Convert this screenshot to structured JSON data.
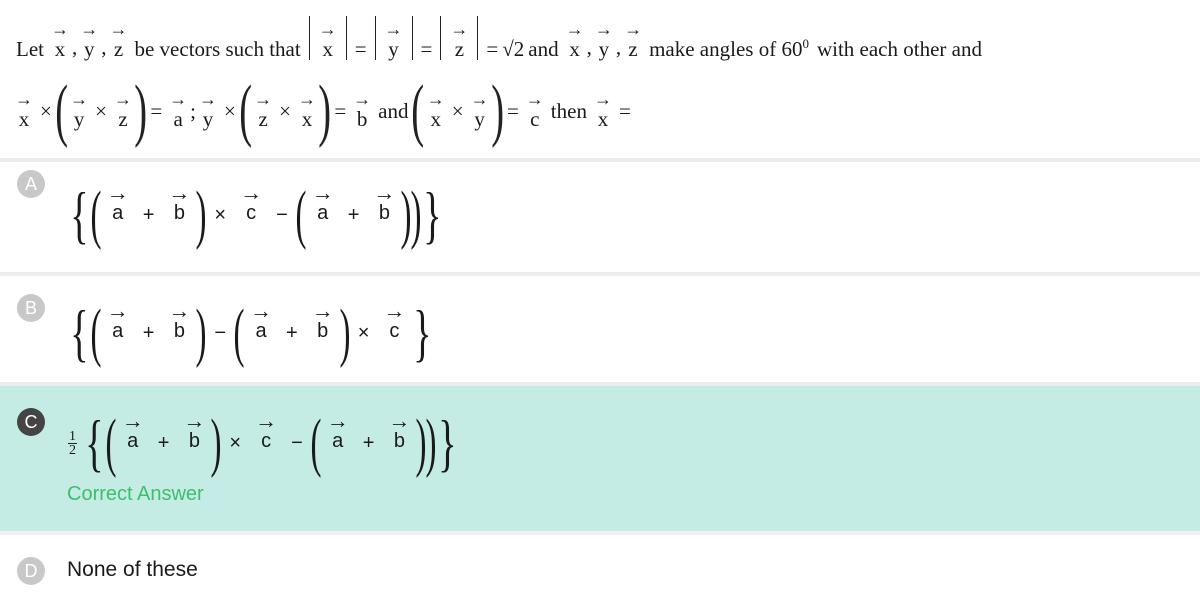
{
  "question": {
    "line1": {
      "lead": "Let",
      "vectors": [
        "x",
        "y",
        "z"
      ],
      "sep": ",",
      "mid": "be vectors such that",
      "magnitudes": [
        "x",
        "y",
        "z"
      ],
      "eq": "=",
      "value": "√2",
      "and": "and",
      "tail": "make angles of 60",
      "deg": "0",
      "end": "with each other and"
    },
    "line2": {
      "x": "x",
      "y": "y",
      "z": "z",
      "cross": "×",
      "eq": "=",
      "a": "a",
      "semicolon": ";",
      "b": "b",
      "and": "and",
      "c": "c",
      "then": "then"
    }
  },
  "options": [
    {
      "letter": "A",
      "type": "expr",
      "selected": false,
      "prefix": "",
      "form": "(a + b) × c − (a + b)"
    },
    {
      "letter": "B",
      "type": "expr",
      "selected": false,
      "prefix": "",
      "form": "(a + b) − (a + b) × c"
    },
    {
      "letter": "C",
      "type": "expr",
      "selected": true,
      "prefix": "1/2",
      "form": "(a + b) × c − (a + b)",
      "status": "Correct Answer"
    },
    {
      "letter": "D",
      "type": "text",
      "selected": false,
      "text": "None of these"
    }
  ],
  "symbols": {
    "arrow": "→",
    "plus": "+",
    "minus": "−",
    "times": "×",
    "lbrace": "{",
    "rbrace": "}",
    "lparen": "(",
    "rparen": ")",
    "frac_num": "1",
    "frac_den": "2",
    "a": "a",
    "b": "b",
    "c": "c"
  },
  "colors": {
    "correct_bg": "#c5ebe5",
    "correct_text": "#3cc06b",
    "selected_badge": "#444444",
    "badge": "#c8c8c8"
  }
}
